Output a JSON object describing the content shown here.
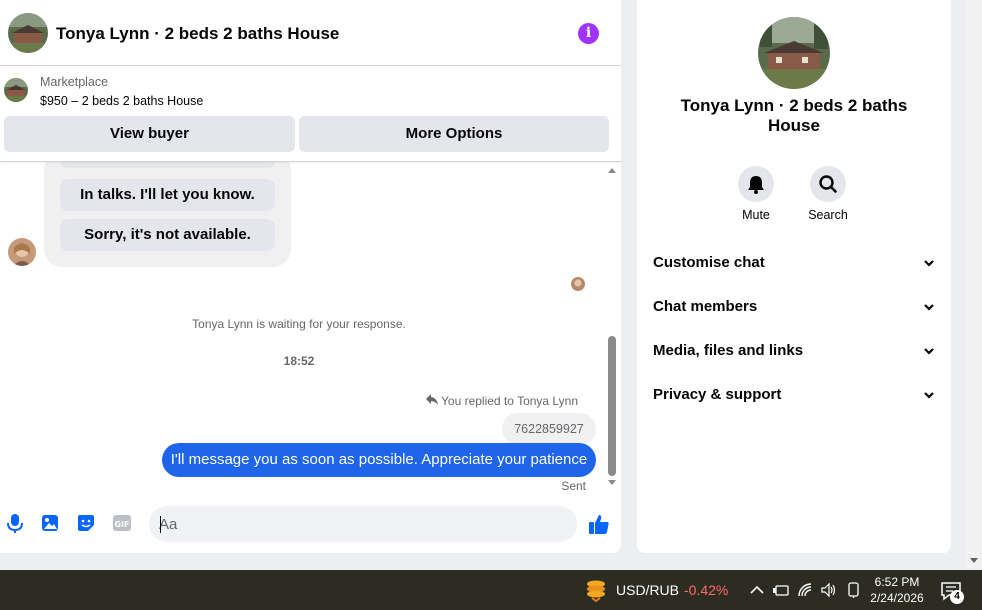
{
  "header": {
    "title": "Tonya Lynn · 2 beds 2 baths House",
    "info_icon": "info-icon"
  },
  "listing": {
    "label": "Marketplace",
    "price_title": "$950 – 2 beds 2 baths House",
    "view_buyer": "View buyer",
    "more_options": "More Options"
  },
  "messages": {
    "quick_replies": [
      "In talks. I'll let you know.",
      "Sorry, it's not available."
    ],
    "waiting": "Tonya Lynn is waiting for your response.",
    "time": "18:52",
    "replied_to": "You replied to Tonya Lynn",
    "quoted": "7622859927",
    "my_message": "I'll message you as soon as possible. Appreciate your patience",
    "status": "Sent"
  },
  "composer": {
    "placeholder": "Aa",
    "icons": [
      "microphone-icon",
      "image-icon",
      "sticker-icon",
      "gif-icon",
      "emoji-icon",
      "thumbs-up-icon"
    ]
  },
  "right_panel": {
    "title": "Tonya Lynn · 2 beds 2 baths House",
    "actions": [
      {
        "label": "Mute",
        "icon": "bell-icon"
      },
      {
        "label": "Search",
        "icon": "search-icon"
      }
    ],
    "sections": [
      "Customise chat",
      "Chat members",
      "Media, files and links",
      "Privacy & support"
    ]
  },
  "taskbar": {
    "ticker_pair": "USD/RUB",
    "ticker_change": "-0.42%",
    "time": "6:52 PM",
    "date": "2/24/2026",
    "notification_count": "4"
  },
  "colors": {
    "accent_blue": "#1e65ea",
    "info_purple": "#a033ff",
    "negative_red": "#ff6b6b",
    "taskbar_bg": "#2c2c22"
  }
}
